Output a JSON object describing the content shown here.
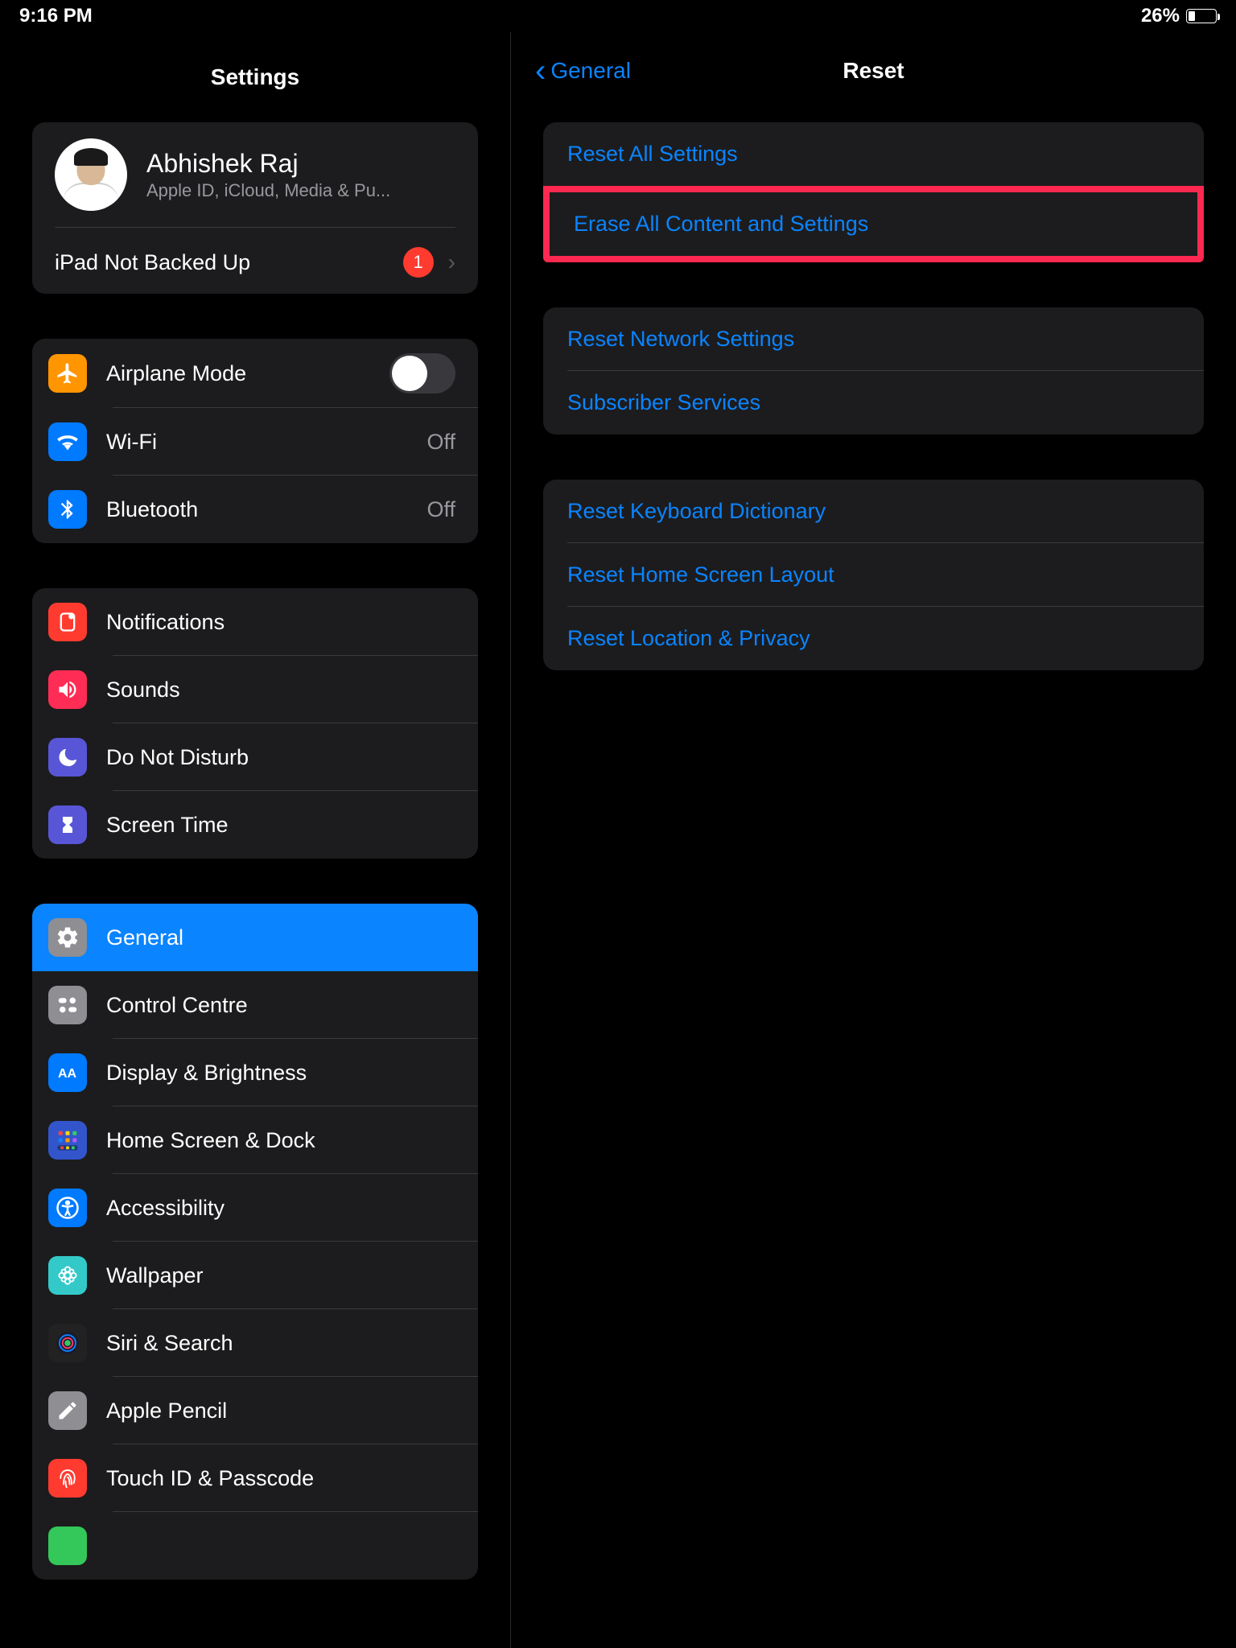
{
  "status": {
    "time": "9:16 PM",
    "battery_pct": "26%"
  },
  "sidebar": {
    "title": "Settings",
    "account": {
      "name": "Abhishek Raj",
      "sub": "Apple ID, iCloud, Media & Pu...",
      "backup_label": "iPad Not Backed Up",
      "badge": "1"
    },
    "group1": {
      "airplane": "Airplane Mode",
      "wifi": "Wi-Fi",
      "wifi_value": "Off",
      "bluetooth": "Bluetooth",
      "bluetooth_value": "Off"
    },
    "group2": {
      "notifications": "Notifications",
      "sounds": "Sounds",
      "dnd": "Do Not Disturb",
      "screentime": "Screen Time"
    },
    "group3": {
      "general": "General",
      "control_centre": "Control Centre",
      "display": "Display & Brightness",
      "home_dock": "Home Screen & Dock",
      "accessibility": "Accessibility",
      "wallpaper": "Wallpaper",
      "siri": "Siri & Search",
      "pencil": "Apple Pencil",
      "touchid": "Touch ID & Passcode"
    }
  },
  "content": {
    "back": "General",
    "title": "Reset",
    "group1": {
      "reset_all": "Reset All Settings",
      "erase_all": "Erase All Content and Settings"
    },
    "group2": {
      "network": "Reset Network Settings",
      "subscriber": "Subscriber Services"
    },
    "group3": {
      "keyboard": "Reset Keyboard Dictionary",
      "home": "Reset Home Screen Layout",
      "location": "Reset Location & Privacy"
    }
  }
}
